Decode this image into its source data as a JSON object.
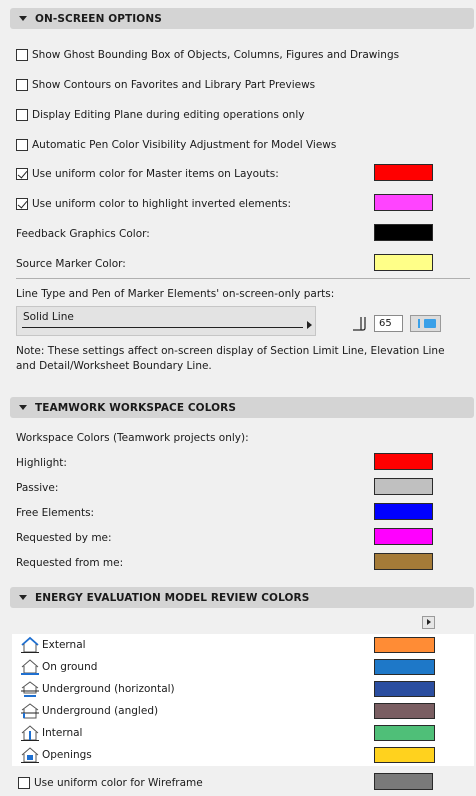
{
  "onscreen": {
    "header": "ON-SCREEN OPTIONS",
    "checkboxes": [
      {
        "label": "Show Ghost Bounding Box of Objects, Columns, Figures and Drawings",
        "checked": false
      },
      {
        "label": "Show Contours on Favorites and Library Part Previews",
        "checked": false
      },
      {
        "label": "Display Editing Plane during editing operations only",
        "checked": false
      },
      {
        "label": "Automatic Pen Color Visibility Adjustment for Model Views",
        "checked": false
      },
      {
        "label": "Use uniform color for Master items on Layouts:",
        "checked": true,
        "color": "#ff0000"
      },
      {
        "label": "Use uniform color to highlight inverted elements:",
        "checked": true,
        "color": "#ff44ff"
      }
    ],
    "feedback_label": "Feedback Graphics Color:",
    "feedback_color": "#000000",
    "source_label": "Source Marker Color:",
    "source_color": "#ffff88",
    "linetype_title": "Line Type and Pen of Marker Elements' on-screen-only parts:",
    "linetype_value": "Solid Line",
    "pen_number": "65",
    "note": "Note: These settings affect on-screen display of Section Limit Line, Elevation Line and Detail/Worksheet Boundary Line."
  },
  "teamwork": {
    "header": "TEAMWORK WORKSPACE COLORS",
    "subtitle": "Workspace Colors (Teamwork projects only):",
    "items": [
      {
        "label": "Highlight:",
        "color": "#ff0000"
      },
      {
        "label": "Passive:",
        "color": "#c0c0c0"
      },
      {
        "label": "Free Elements:",
        "color": "#0000ff"
      },
      {
        "label": "Requested by me:",
        "color": "#ff00ff"
      },
      {
        "label": "Requested from me:",
        "color": "#a57b38"
      }
    ]
  },
  "energy": {
    "header": "ENERGY EVALUATION MODEL REVIEW COLORS",
    "items": [
      {
        "label": "External",
        "icon": "house-external-icon",
        "color": "#ff8c35"
      },
      {
        "label": "On ground",
        "icon": "house-on-ground-icon",
        "color": "#1e78c8"
      },
      {
        "label": "Underground (horizontal)",
        "icon": "house-underground-horizontal-icon",
        "color": "#2b4ea0"
      },
      {
        "label": "Underground (angled)",
        "icon": "house-underground-angled-icon",
        "color": "#7a5e62"
      },
      {
        "label": "Internal",
        "icon": "house-internal-icon",
        "color": "#4fbf78"
      },
      {
        "label": "Openings",
        "icon": "house-openings-icon",
        "color": "#ffd21e"
      }
    ],
    "wireframe_label": "Use uniform color for Wireframe",
    "wireframe_checked": false,
    "wireframe_color": "#7a7a7a"
  }
}
